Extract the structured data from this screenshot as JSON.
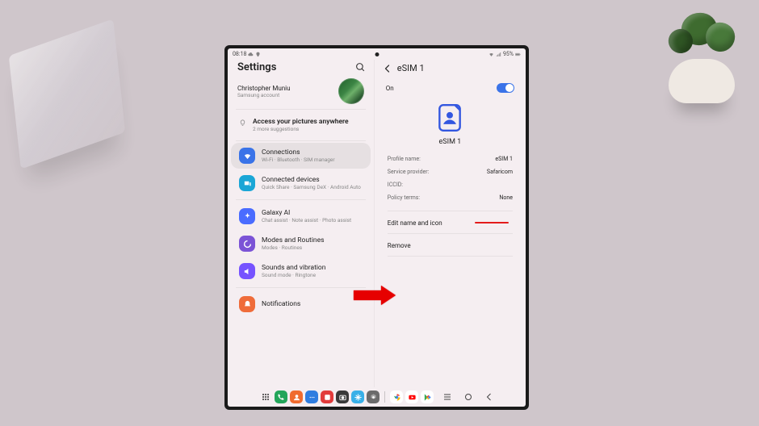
{
  "statusbar": {
    "time": "08:18",
    "battery": "95%"
  },
  "left": {
    "title": "Settings",
    "profile": {
      "name": "Christopher Muniu",
      "sub": "Samsung account"
    },
    "suggestion": {
      "title": "Access your pictures anywhere",
      "sub": "2 more suggestions"
    },
    "items": [
      {
        "label": "Connections",
        "sub": "Wi-Fi · Bluetooth · SIM manager",
        "color": "#3a73e8",
        "icon": "wifi"
      },
      {
        "label": "Connected devices",
        "sub": "Quick Share · Samsung DeX · Android Auto",
        "color": "#1aa6d6",
        "icon": "devices"
      },
      {
        "label": "Galaxy AI",
        "sub": "Chat assist · Note assist · Photo assist",
        "color": "#4a6cff",
        "icon": "ai"
      },
      {
        "label": "Modes and Routines",
        "sub": "Modes · Routines",
        "color": "#7b53d6",
        "icon": "routines"
      },
      {
        "label": "Sounds and vibration",
        "sub": "Sound mode · Ringtone",
        "color": "#7653ff",
        "icon": "sound"
      },
      {
        "label": "Notifications",
        "sub": "",
        "color": "#ef6c3a",
        "icon": "notif"
      }
    ]
  },
  "right": {
    "title": "eSIM 1",
    "toggle_label": "On",
    "sim_name": "eSIM 1",
    "kv": [
      {
        "k": "Profile name:",
        "v": "eSIM 1"
      },
      {
        "k": "Service provider:",
        "v": "Safaricom"
      },
      {
        "k": "ICCID:",
        "v": ""
      },
      {
        "k": "Policy terms:",
        "v": "None"
      }
    ],
    "actions": {
      "edit": "Edit name and icon",
      "remove": "Remove"
    }
  },
  "taskbar": {
    "apps": [
      "phone",
      "contacts",
      "messages",
      "gallery",
      "camera",
      "snow",
      "settings",
      "chrome",
      "youtube",
      "playstore"
    ]
  }
}
